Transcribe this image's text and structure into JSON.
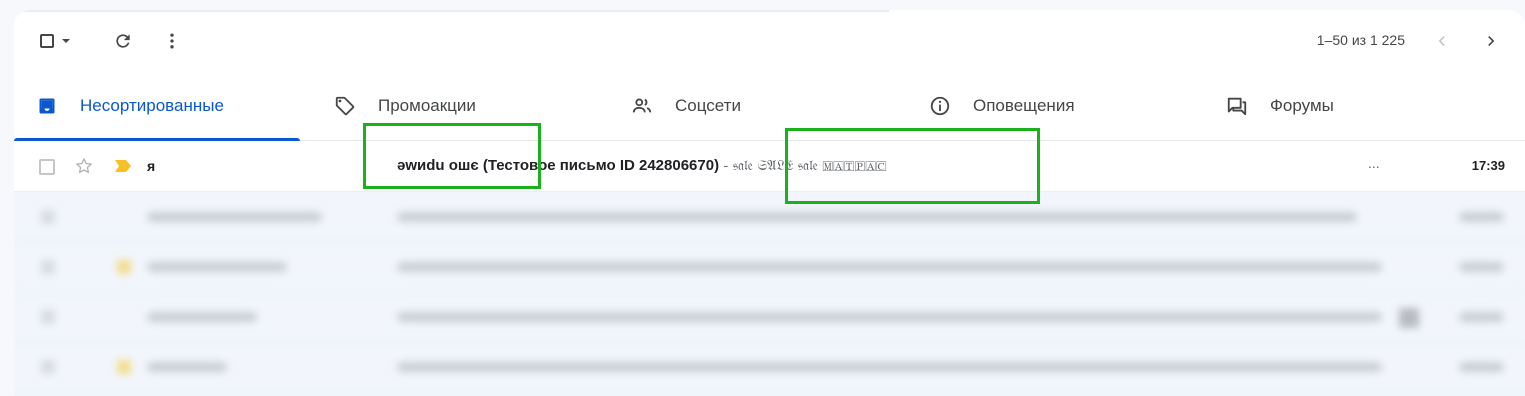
{
  "toolbar": {
    "select_icon": "checkbox-icon",
    "refresh_icon": "refresh-icon",
    "more_icon": "more-vert-icon",
    "pager_text": "1–50 из 1 225"
  },
  "tabs": [
    {
      "label": "Несортированные",
      "icon": "inbox-icon",
      "active": true
    },
    {
      "label": "Промоакции",
      "icon": "tag-icon",
      "active": false
    },
    {
      "label": "Соцсети",
      "icon": "people-icon",
      "active": false
    },
    {
      "label": "Оповещения",
      "icon": "info-icon",
      "active": false
    },
    {
      "label": "Форумы",
      "icon": "forum-icon",
      "active": false
    }
  ],
  "emails": [
    {
      "sender": "я",
      "subject": "ǝwиdu oшє (Тестовое письмо ID 242806670)",
      "snippet": " - 𝔰𝔞𝔩𝔢 𝔖𝔄𝔏𝔈 𝔰𝔞𝔩𝔢 🄼🄰🅃🄿🄰🄲",
      "ellipsis": "...",
      "time": "17:39",
      "important": true
    }
  ],
  "colors": {
    "accent": "#0b57d0",
    "highlight": "#19b21b",
    "important": "#f6c026"
  }
}
